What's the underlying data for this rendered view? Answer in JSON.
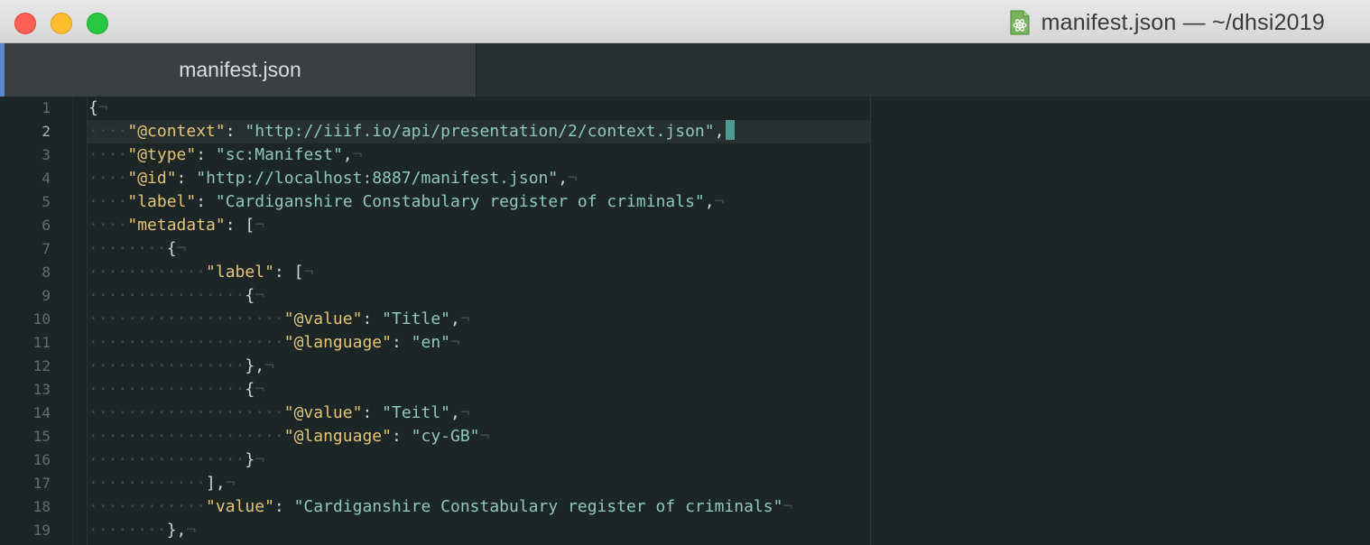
{
  "window": {
    "title": "manifest.json — ~/dhsi2019"
  },
  "tabs": [
    {
      "label": "manifest.json",
      "active": true
    }
  ],
  "colors": {
    "accent": "#5a86d6",
    "key": "#e3c576",
    "string": "#8fc9b9",
    "cursor": "#4f9a8e"
  },
  "icons": {
    "window_icon": "atom-icon"
  },
  "editor": {
    "cursor_line": 2,
    "lines": [
      {
        "n": "1",
        "text": "{"
      },
      {
        "n": "2",
        "text": "    \"@context\": \"http://iiif.io/api/presentation/2/context.json\","
      },
      {
        "n": "3",
        "text": "    \"@type\": \"sc:Manifest\","
      },
      {
        "n": "4",
        "text": "    \"@id\": \"http://localhost:8887/manifest.json\","
      },
      {
        "n": "5",
        "text": "    \"label\": \"Cardiganshire Constabulary register of criminals\","
      },
      {
        "n": "6",
        "text": "    \"metadata\": ["
      },
      {
        "n": "7",
        "text": "        {"
      },
      {
        "n": "8",
        "text": "            \"label\": ["
      },
      {
        "n": "9",
        "text": "                {"
      },
      {
        "n": "10",
        "text": "                    \"@value\": \"Title\","
      },
      {
        "n": "11",
        "text": "                    \"@language\": \"en\""
      },
      {
        "n": "12",
        "text": "                },"
      },
      {
        "n": "13",
        "text": "                {"
      },
      {
        "n": "14",
        "text": "                    \"@value\": \"Teitl\","
      },
      {
        "n": "15",
        "text": "                    \"@language\": \"cy-GB\""
      },
      {
        "n": "16",
        "text": "                }"
      },
      {
        "n": "17",
        "text": "            ],"
      },
      {
        "n": "18",
        "text": "            \"value\": \"Cardiganshire Constabulary register of criminals\""
      },
      {
        "n": "19",
        "text": "        },"
      }
    ]
  }
}
